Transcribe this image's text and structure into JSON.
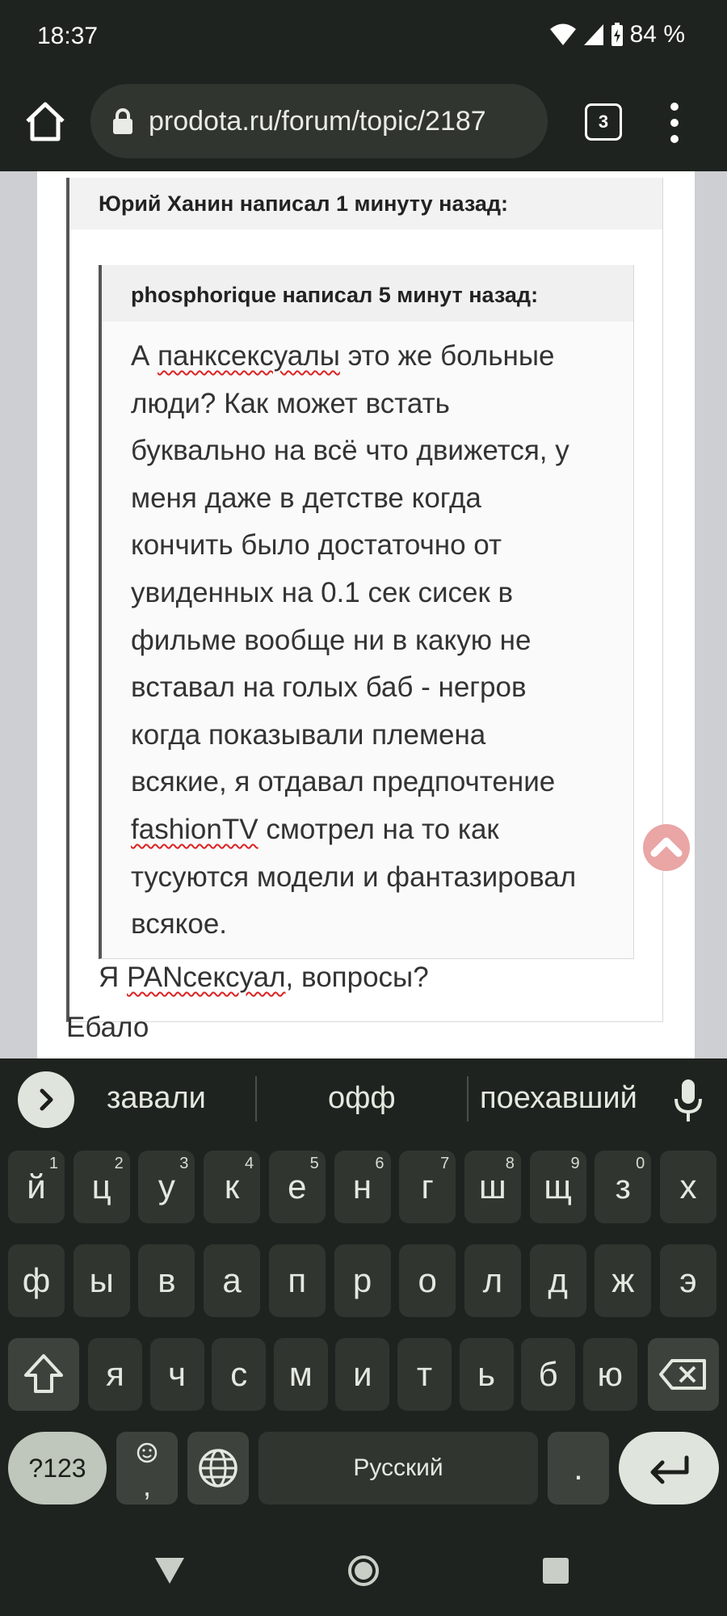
{
  "status": {
    "time": "18:37",
    "battery": "84 %"
  },
  "browser": {
    "url": "prodota.ru/forum/topic/2187",
    "tab_count": "3"
  },
  "post": {
    "outer_author": "Юрий Ханин написал 1 минуту назад:",
    "inner_author": "phosphorique написал 5 минут назад:",
    "inner_lines": [
      [
        "А ",
        {
          "sp": "панксексуалы"
        },
        " это же больные"
      ],
      [
        "люди? Как может встать"
      ],
      [
        "буквально на всё что движется, у"
      ],
      [
        "меня даже в детстве когда"
      ],
      [
        "кончить было достаточно от"
      ],
      [
        "увиденных на 0.1 сек сисек в"
      ],
      [
        "фильме вообще ни в какую не"
      ],
      [
        "вставал на голых баб - негров"
      ],
      [
        "когда показывали племена"
      ],
      [
        "всякие, я отдавал предпочтение"
      ],
      [
        {
          "sp": "fashionTV"
        },
        " смотрел на то как"
      ],
      [
        "тусуются модели и фантазировал"
      ],
      [
        "всякое."
      ]
    ],
    "reply_pre": "Я ",
    "reply_sp": "PANсексуал",
    "reply_post": ", вопросы?",
    "after_text": "Ебало"
  },
  "keyboard": {
    "suggestions": [
      "завали",
      "офф",
      "поехавший"
    ],
    "row1": [
      [
        "й",
        "1"
      ],
      [
        "ц",
        "2"
      ],
      [
        "у",
        "3"
      ],
      [
        "к",
        "4"
      ],
      [
        "е",
        "5"
      ],
      [
        "н",
        "6"
      ],
      [
        "г",
        "7"
      ],
      [
        "ш",
        "8"
      ],
      [
        "щ",
        "9"
      ],
      [
        "з",
        "0"
      ],
      [
        "х",
        ""
      ]
    ],
    "row2": [
      "ф",
      "ы",
      "в",
      "а",
      "п",
      "р",
      "о",
      "л",
      "д",
      "ж",
      "э"
    ],
    "row3": [
      "я",
      "ч",
      "с",
      "м",
      "и",
      "т",
      "ь",
      "б",
      "ю"
    ],
    "symbols_label": "?123",
    "emoji_comma": ",",
    "space_label": "Русский",
    "period_label": "."
  },
  "colors": {
    "bg": "#1f231f",
    "key": "#303530",
    "accent_scroll": "#eaa5a5"
  }
}
